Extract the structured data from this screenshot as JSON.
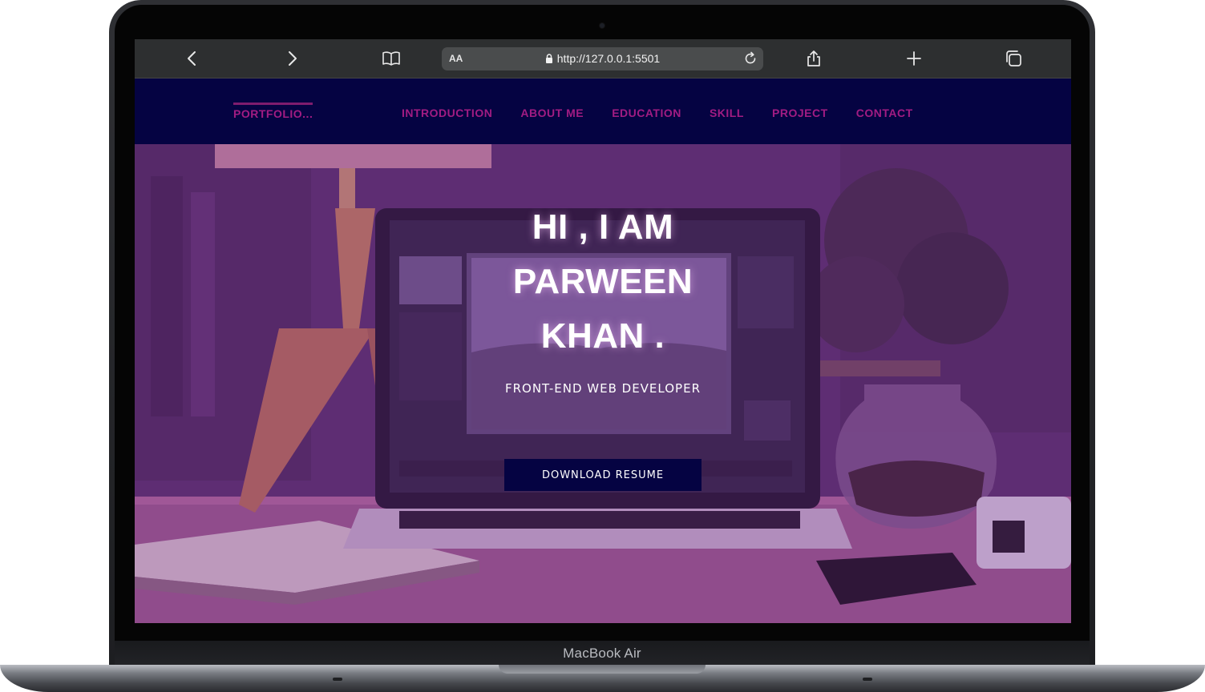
{
  "device": {
    "model_label": "MacBook Air"
  },
  "browser": {
    "text_size_label": "AA",
    "url": "http://127.0.0.1:5501",
    "icons": [
      "back-icon",
      "forward-icon",
      "bookmarks-icon",
      "lock-icon",
      "reload-icon",
      "share-icon",
      "new-tab-icon",
      "tabs-icon"
    ]
  },
  "site": {
    "logo": "PORTFOLIO...",
    "nav": [
      "INTRODUCTION",
      "ABOUT ME",
      "EDUCATION",
      "SKILL",
      "PROJECT",
      "CONTACT"
    ],
    "hero": {
      "title_line_1": "HI , I AM",
      "title_line_2": "PARWEEN",
      "title_line_3": "KHAN .",
      "subtitle": "FRONT-END WEB DEVELOPER",
      "button": "DOWNLOAD RESUME"
    }
  },
  "colors": {
    "nav_background": "#050342",
    "nav_text": "#a21c83",
    "hero_overlay": "#7a2a8c",
    "button_background": "#050342"
  }
}
